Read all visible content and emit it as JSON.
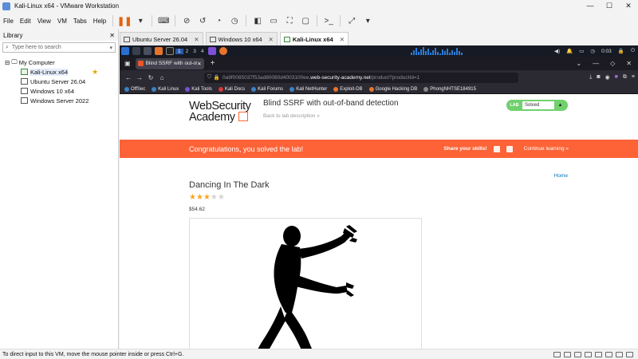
{
  "window": {
    "title": "Kali-Linux x64 - VMware Workstation",
    "controls": [
      "—",
      "☐",
      "✕"
    ]
  },
  "menu": [
    "File",
    "Edit",
    "View",
    "VM",
    "Tabs",
    "Help"
  ],
  "library": {
    "title": "Library",
    "close": "✕",
    "search_placeholder": "Type here to search",
    "root": "My Computer",
    "vms": [
      "Kali-Linux x64",
      "Ubuntu Server 26.04",
      "Windows 10 x64",
      "Windows Server 2022"
    ],
    "selected": "Kali-Linux x64"
  },
  "vm_tabs": [
    {
      "label": "Ubuntu Server 26.04",
      "close": "✕"
    },
    {
      "label": "Windows 10 x64",
      "close": "✕"
    },
    {
      "label": "Kali-Linux x64",
      "close": "✕",
      "active": true
    }
  ],
  "kali": {
    "workspaces": [
      "1",
      "2",
      "3",
      "4"
    ],
    "active_workspace": "1",
    "clock": "0:03"
  },
  "browser": {
    "tab_title": "Blind SSRF with out-of-b",
    "url_prefix": "0a9f0085037f53ad80080d4003100ee",
    "url_domain": ".web-security-academy.net",
    "url_path": "/product?productId=1",
    "bookmarks": [
      "OffSec",
      "Kali Linux",
      "Kali Tools",
      "Kali Docs",
      "Kali Forums",
      "Kali NetHunter",
      "Exploit-DB",
      "Google Hacking DB",
      "PhongNHTSE184915"
    ]
  },
  "page": {
    "logo_line1": "WebSecurity",
    "logo_line2": "Academy",
    "lab_title": "Blind SSRF with out-of-band detection",
    "back_link": "Back to lab description  »",
    "lab_badge": "LAB",
    "lab_status": "Solved",
    "banner_text": "Congratulations, you solved the lab!",
    "share_text": "Share your skills!",
    "continue_text": "Continue learning »",
    "home_link": "Home",
    "product_title": "Dancing In The Dark",
    "rating": 3,
    "rating_max": 5,
    "price": "$54.62"
  },
  "status_bar": {
    "text": "To direct input to this VM, move the mouse pointer inside or press Ctrl+G."
  },
  "colors": {
    "banner": "#fd6337",
    "solved": "#70d16d",
    "kali_panel": "#161a24",
    "firefox_dark": "#2b2a33"
  }
}
